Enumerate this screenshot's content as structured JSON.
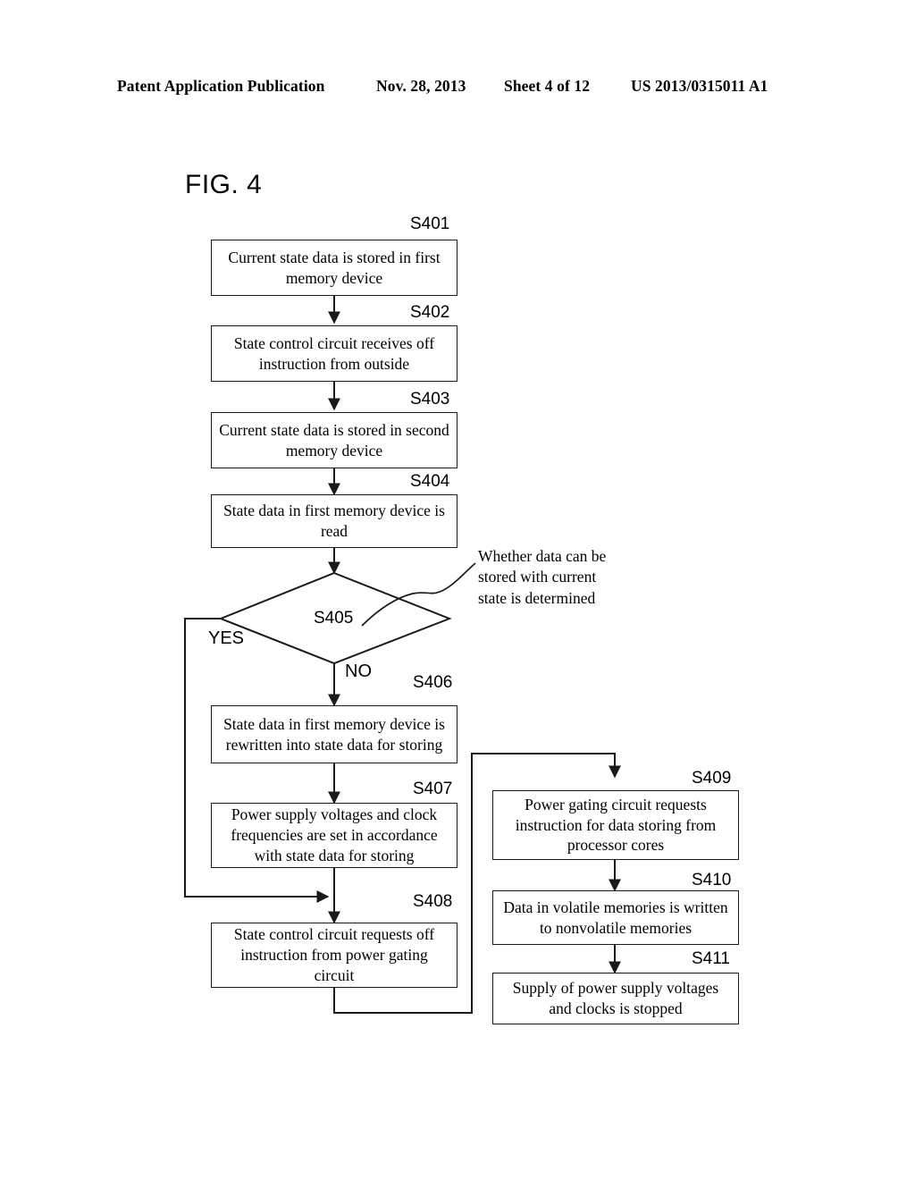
{
  "page_header": {
    "publication": "Patent Application Publication",
    "date": "Nov. 28, 2013",
    "sheet": "Sheet 4 of 12",
    "patent_number": "US 2013/0315011 A1"
  },
  "figure": {
    "title": "FIG. 4",
    "type": "flowchart"
  },
  "flowchart": {
    "nodes": [
      {
        "id": "S401",
        "label": "S401",
        "shape": "process",
        "text": "Current state data is stored in first memory device"
      },
      {
        "id": "S402",
        "label": "S402",
        "shape": "process",
        "text": "State control circuit receives off instruction from outside"
      },
      {
        "id": "S403",
        "label": "S403",
        "shape": "process",
        "text": "Current state data is stored in second memory device"
      },
      {
        "id": "S404",
        "label": "S404",
        "shape": "process",
        "text": "State data in first memory device is read"
      },
      {
        "id": "S405",
        "label": "S405",
        "shape": "decision",
        "text": ""
      },
      {
        "id": "S406",
        "label": "S406",
        "shape": "process",
        "text": "State data in first memory device is rewritten into state data for storing"
      },
      {
        "id": "S407",
        "label": "S407",
        "shape": "process",
        "text": "Power supply voltages and clock frequencies are set in accordance with state data for storing"
      },
      {
        "id": "S408",
        "label": "S408",
        "shape": "process",
        "text": "State control circuit requests off instruction from power gating circuit"
      },
      {
        "id": "S409",
        "label": "S409",
        "shape": "process",
        "text": "Power gating circuit requests instruction for data storing from processor cores"
      },
      {
        "id": "S410",
        "label": "S410",
        "shape": "process",
        "text": "Data in volatile memories is written to nonvolatile memories"
      },
      {
        "id": "S411",
        "label": "S411",
        "shape": "process",
        "text": "Supply of power supply voltages and clocks is stopped"
      }
    ],
    "branch_labels": {
      "yes": "YES",
      "no": "NO"
    },
    "annotation": "Whether data can be\nstored with current\nstate is determined",
    "line_color": "#1a1a1a"
  }
}
